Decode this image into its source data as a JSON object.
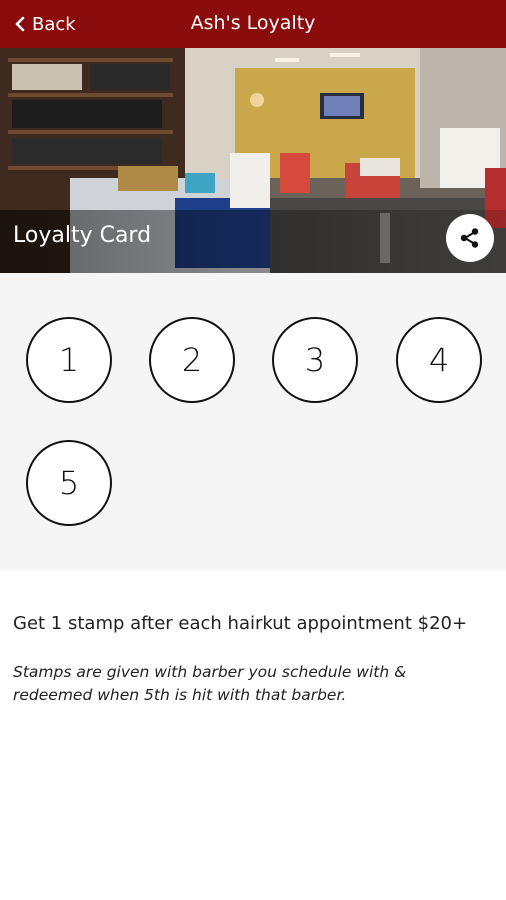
{
  "header": {
    "back_label": "Back",
    "title": "Ash's Loyalty",
    "color": "#8b0c0c"
  },
  "hero": {
    "title": "Loyalty Card",
    "share_icon": "share-icon"
  },
  "stamps": [
    "1",
    "2",
    "3",
    "4",
    "5"
  ],
  "info": {
    "description": "Get 1 stamp after each hairkut appointment $20+",
    "note": "Stamps are given with barber you schedule with & redeemed when 5th is hit with that barber."
  }
}
